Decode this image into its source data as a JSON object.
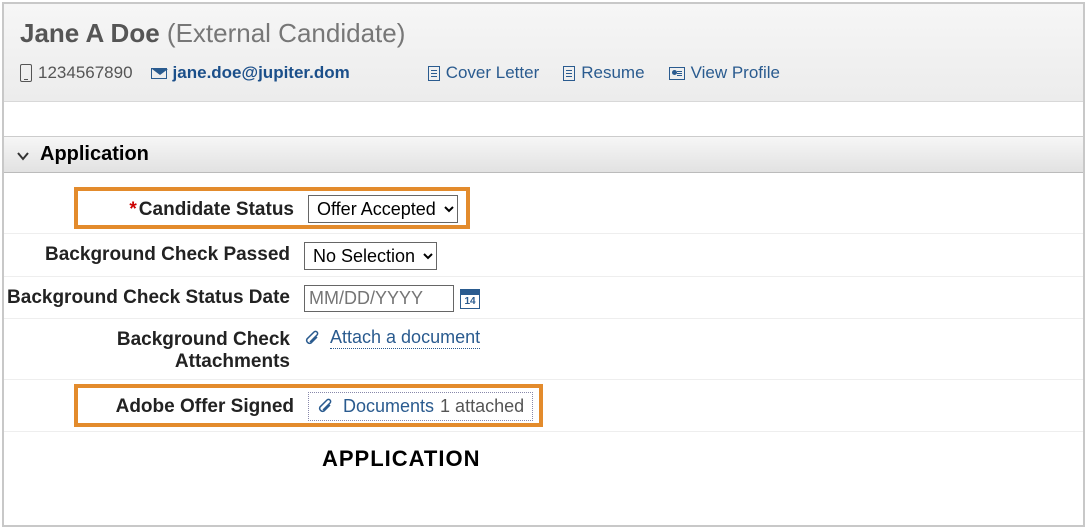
{
  "header": {
    "name": "Jane  A  Doe",
    "subtitle": "(External Candidate)",
    "phone": "1234567890",
    "email": "jane.doe@jupiter.dom",
    "links": {
      "cover_letter": "Cover  Letter",
      "resume": "Resume",
      "view_profile": "View  Profile"
    }
  },
  "section": {
    "title": "Application"
  },
  "fields": {
    "candidate_status": {
      "label": "Candidate Status",
      "value": "Offer Accepted",
      "required": true
    },
    "bg_check_passed": {
      "label": "Background Check Passed",
      "value": "No Selection"
    },
    "bg_check_date": {
      "label": "Background Check Status Date",
      "placeholder": "MM/DD/YYYY",
      "cal_day": "14"
    },
    "bg_check_attach": {
      "label": "Background Check Attachments",
      "link": "Attach a document"
    },
    "adobe_offer": {
      "label": "Adobe Offer Signed",
      "link": "Documents",
      "count": "1 attached"
    }
  },
  "subheading": "APPLICATION"
}
